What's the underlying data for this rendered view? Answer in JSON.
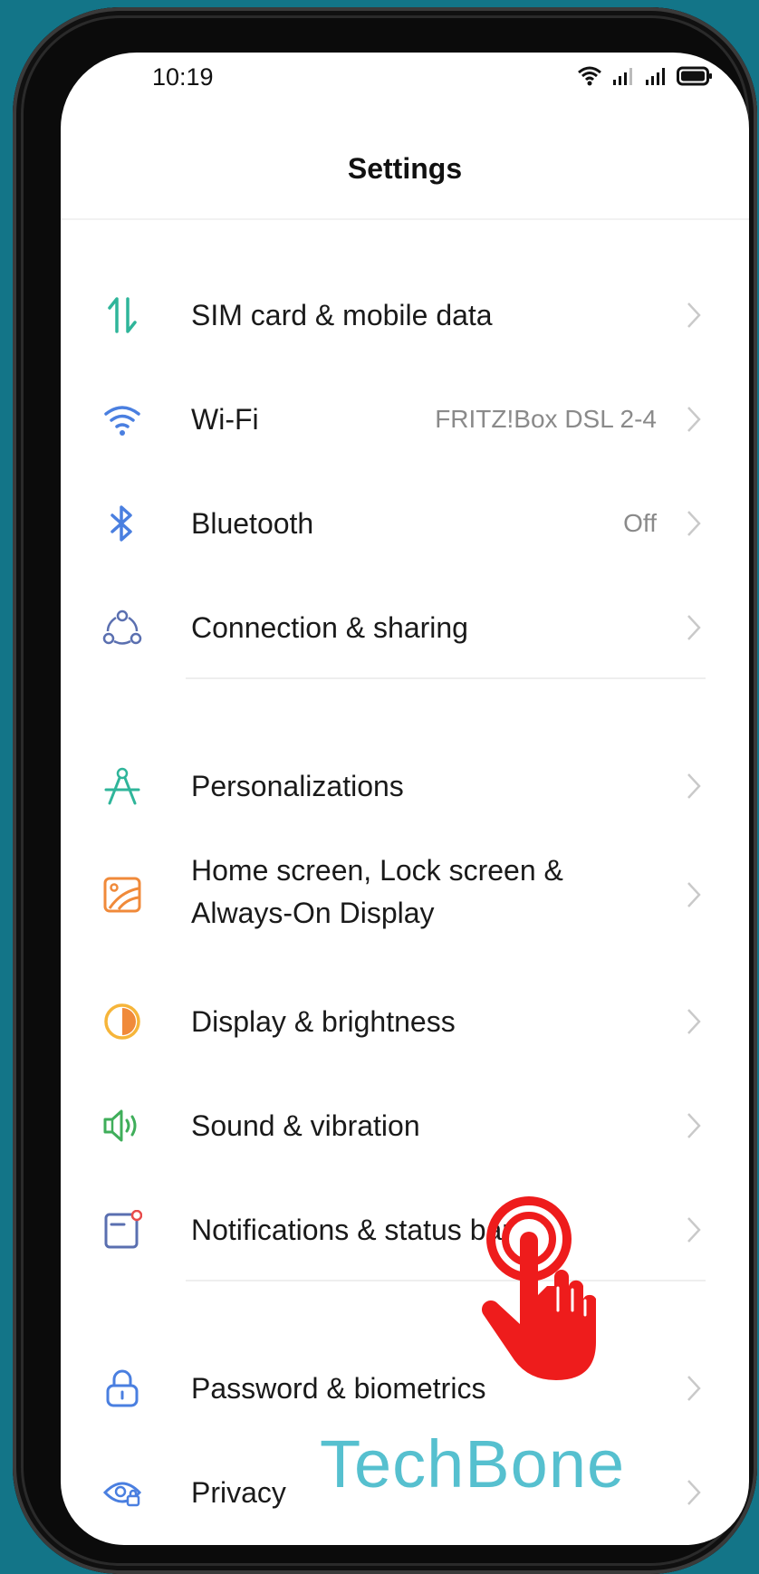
{
  "status_bar": {
    "time": "10:19"
  },
  "header": {
    "title": "Settings"
  },
  "items": [
    {
      "key": "sim",
      "label": "SIM card & mobile data",
      "value": "",
      "icon": "sim-data-icon"
    },
    {
      "key": "wifi",
      "label": "Wi-Fi",
      "value": "FRITZ!Box DSL 2-4",
      "icon": "wifi-icon"
    },
    {
      "key": "bluetooth",
      "label": "Bluetooth",
      "value": "Off",
      "icon": "bluetooth-icon"
    },
    {
      "key": "connection",
      "label": "Connection & sharing",
      "value": "",
      "icon": "connection-sharing-icon"
    },
    {
      "key": "personalizations",
      "label": "Personalizations",
      "value": "",
      "icon": "compass-icon"
    },
    {
      "key": "homescreen",
      "label_line1": "Home screen, Lock screen &",
      "label_line2": "Always-On Display",
      "value": "",
      "icon": "wallpaper-icon"
    },
    {
      "key": "display",
      "label": "Display & brightness",
      "value": "",
      "icon": "brightness-icon"
    },
    {
      "key": "sound",
      "label": "Sound & vibration",
      "value": "",
      "icon": "speaker-icon"
    },
    {
      "key": "notifications",
      "label": "Notifications & status bar",
      "value": "",
      "icon": "notification-icon"
    },
    {
      "key": "password",
      "label": "Password & biometrics",
      "value": "",
      "icon": "lock-icon"
    },
    {
      "key": "privacy",
      "label": "Privacy",
      "value": "",
      "icon": "privacy-eye-icon"
    }
  ],
  "watermark": "TechBone",
  "colors": {
    "background": "#137588",
    "accent_green": "#2fb59a",
    "accent_blue": "#4a7fe0",
    "accent_orange": "#f08a3a",
    "accent_yellow": "#f6b53a",
    "sound_green": "#3fae5a",
    "hand_red": "#ee1c1c",
    "watermark": "#56c0cf"
  }
}
